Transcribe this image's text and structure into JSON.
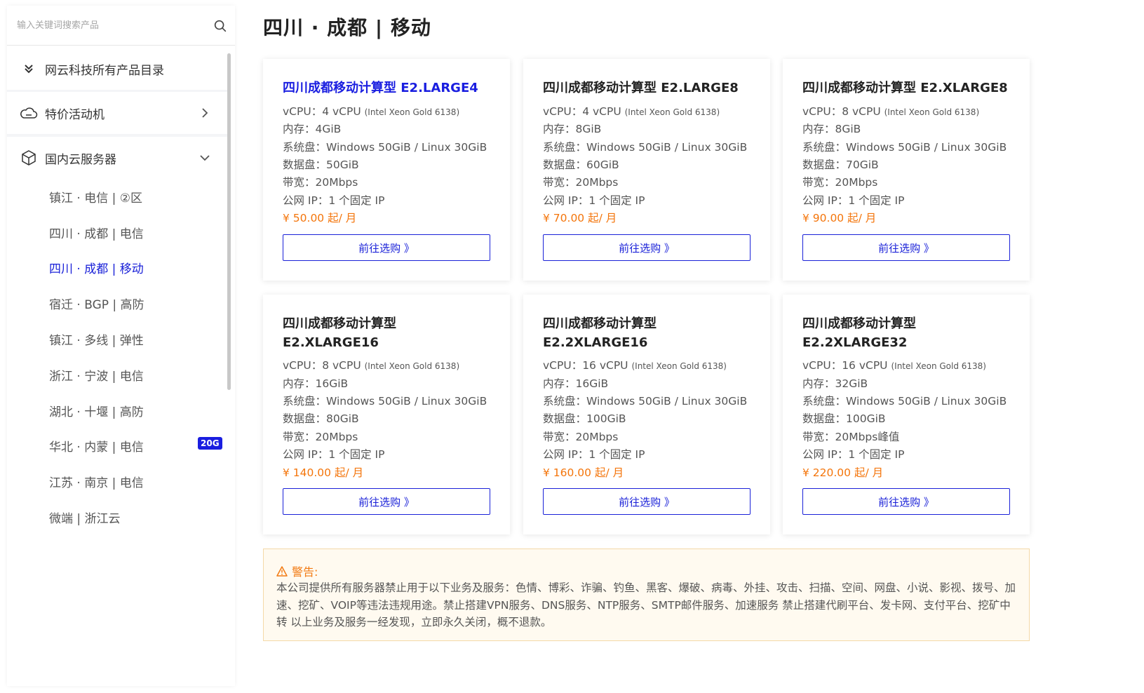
{
  "search": {
    "placeholder": "输入关键词搜索产品"
  },
  "sidebar": {
    "catalog_label": "网云科技所有产品目录",
    "promo_label": "特价活动机",
    "domestic_label": "国内云服务器",
    "items": [
      {
        "label": "镇江 · 电信 | ②区"
      },
      {
        "label": "四川 · 成都 | 电信"
      },
      {
        "label": "四川 · 成都 | 移动"
      },
      {
        "label": "宿迁 · BGP | 高防"
      },
      {
        "label": "镇江 · 多线 | 弹性"
      },
      {
        "label": "浙江 · 宁波 | 电信"
      },
      {
        "label": "湖北 · 十堰 | 高防"
      },
      {
        "label": "华北 · 内蒙 | 电信",
        "badge": "20G"
      },
      {
        "label": "江苏 · 南京 | 电信"
      },
      {
        "label": "微端 | 浙江云"
      }
    ]
  },
  "page_title": "四川 · 成都 | 移动",
  "cards": [
    {
      "title": "四川成都移动计算型 E2.LARGE4",
      "vcpu": "vCPU：4 vCPU",
      "cpu_model": "(Intel Xeon Gold 6138)",
      "memory": "内存：4GiB",
      "system_disk": "系统盘：Windows 50GiB / Linux 30GiB",
      "data_disk": "数据盘：50GiB",
      "bandwidth": "带宽：20Mbps",
      "ip": "公网 IP：1 个固定 IP",
      "price": "¥ 50.00 起/ 月",
      "button": "前往选购 》"
    },
    {
      "title": "四川成都移动计算型 E2.LARGE8",
      "vcpu": "vCPU：4 vCPU",
      "cpu_model": "(Intel Xeon Gold 6138)",
      "memory": "内存：8GiB",
      "system_disk": "系统盘：Windows 50GiB / Linux 30GiB",
      "data_disk": "数据盘：60GiB",
      "bandwidth": "带宽：20Mbps",
      "ip": "公网 IP：1 个固定 IP",
      "price": "¥ 70.00 起/ 月",
      "button": "前往选购 》"
    },
    {
      "title": "四川成都移动计算型 E2.XLARGE8",
      "vcpu": "vCPU：8 vCPU",
      "cpu_model": "(Intel Xeon Gold 6138)",
      "memory": "内存：8GiB",
      "system_disk": "系统盘：Windows 50GiB / Linux 30GiB",
      "data_disk": "数据盘：70GiB",
      "bandwidth": "带宽：20Mbps",
      "ip": "公网 IP：1 个固定 IP",
      "price": "¥ 90.00 起/ 月",
      "button": "前往选购 》"
    },
    {
      "title": "四川成都移动计算型 E2.XLARGE16",
      "vcpu": "vCPU：8 vCPU",
      "cpu_model": "(Intel Xeon Gold 6138)",
      "memory": "内存：16GiB",
      "system_disk": "系统盘：Windows 50GiB / Linux 30GiB",
      "data_disk": "数据盘：80GiB",
      "bandwidth": "带宽：20Mbps",
      "ip": "公网 IP：1 个固定 IP",
      "price": "¥ 140.00 起/ 月",
      "button": "前往选购 》"
    },
    {
      "title": "四川成都移动计算型 E2.2XLARGE16",
      "vcpu": "vCPU：16 vCPU",
      "cpu_model": "(Intel Xeon Gold 6138)",
      "memory": "内存：16GiB",
      "system_disk": "系统盘：Windows 50GiB / Linux 30GiB",
      "data_disk": "数据盘：100GiB",
      "bandwidth": "带宽：20Mbps",
      "ip": "公网 IP：1 个固定 IP",
      "price": "¥ 160.00 起/ 月",
      "button": "前往选购 》"
    },
    {
      "title": "四川成都移动计算型 E2.2XLARGE32",
      "vcpu": "vCPU：16 vCPU",
      "cpu_model": "(Intel Xeon Gold 6138)",
      "memory": "内存：32GiB",
      "system_disk": "系统盘：Windows 50GiB / Linux 30GiB",
      "data_disk": "数据盘：100GiB",
      "bandwidth": "带宽：20Mbps峰值",
      "ip": "公网 IP：1 个固定 IP",
      "price": "¥ 220.00 起/ 月",
      "button": "前往选购 》"
    }
  ],
  "warning": {
    "title": "警告:",
    "text": "本公司提供所有服务器禁止用于以下业务及服务：色情、博彩、诈骗、钓鱼、黑客、爆破、病毒、外挂、攻击、扫描、空间、网盘、小说、影视、拨号、加速、挖矿、VOIP等违法违规用途。禁止搭建VPN服务、DNS服务、NTP服务、SMTP邮件服务、加速服务 禁止搭建代刷平台、发卡网、支付平台、挖矿中转 以上业务及服务一经发现，立即永久关闭，概不退款。"
  },
  "colors": {
    "accent": "#1a21d8",
    "price": "#f4750b",
    "warning": "#f27a12"
  }
}
